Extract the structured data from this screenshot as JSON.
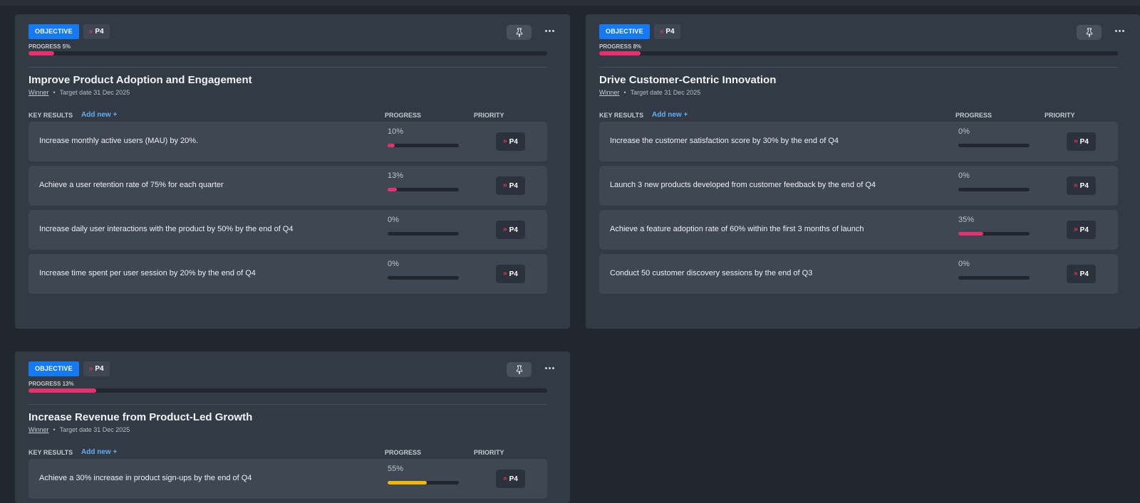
{
  "colors": {
    "background": "#22262e",
    "card": "#323a44",
    "objective_badge": "#1479f5",
    "progress_pink": "#e8306e",
    "progress_yellow": "#f5b800",
    "link_blue": "#62aef5",
    "priority_chevron": "#e8305d"
  },
  "labels": {
    "key_results": "KEY RESULTS",
    "add_new": "Add new +",
    "progress_col": "PROGRESS",
    "priority_col": "PRIORITY"
  },
  "objectives": [
    {
      "badge": "OBJECTIVE",
      "priority": "P4",
      "progress_label": "PROGRESS 5%",
      "progress": 5,
      "title": "Improve Product Adoption and Engagement",
      "owner": "Winner",
      "target": "Target date 31 Dec 2025",
      "key_results": [
        {
          "text": "Increase monthly active users (MAU) by 20%.",
          "pct": "10%",
          "progress": 10,
          "priority": "P4",
          "color": "pink"
        },
        {
          "text": "Achieve a user retention rate of 75% for each quarter",
          "pct": "13%",
          "progress": 13,
          "priority": "P4",
          "color": "pink"
        },
        {
          "text": "Increase daily user interactions with the product by 50% by the end of Q4",
          "pct": "0%",
          "progress": 0,
          "priority": "P4",
          "color": "pink"
        },
        {
          "text": "Increase time spent per user session by 20% by the end of Q4",
          "pct": "0%",
          "progress": 0,
          "priority": "P4",
          "color": "pink"
        }
      ]
    },
    {
      "badge": "OBJECTIVE",
      "priority": "P4",
      "progress_label": "PROGRESS 8%",
      "progress": 8,
      "title": "Drive Customer-Centric Innovation",
      "owner": "Winner",
      "target": "Target date 31 Dec 2025",
      "key_results": [
        {
          "text": "Increase the customer satisfaction score by 30% by the end of Q4",
          "pct": "0%",
          "progress": 0,
          "priority": "P4",
          "color": "pink"
        },
        {
          "text": "Launch 3 new products developed from customer feedback by the end of Q4",
          "pct": "0%",
          "progress": 0,
          "priority": "P4",
          "color": "pink"
        },
        {
          "text": "Achieve a feature adoption rate of 60% within the first 3 months of launch",
          "pct": "35%",
          "progress": 35,
          "priority": "P4",
          "color": "pink"
        },
        {
          "text": "Conduct 50 customer discovery sessions by the end of Q3",
          "pct": "0%",
          "progress": 0,
          "priority": "P4",
          "color": "pink"
        }
      ]
    },
    {
      "badge": "OBJECTIVE",
      "priority": "P4",
      "progress_label": "PROGRESS 13%",
      "progress": 13,
      "title": "Increase Revenue from Product-Led Growth",
      "owner": "Winner",
      "target": "Target date 31 Dec 2025",
      "key_results": [
        {
          "text": "Achieve a 30% increase in product sign-ups by the end of Q4",
          "pct": "55%",
          "progress": 55,
          "priority": "P4",
          "color": "yellow"
        }
      ]
    }
  ]
}
